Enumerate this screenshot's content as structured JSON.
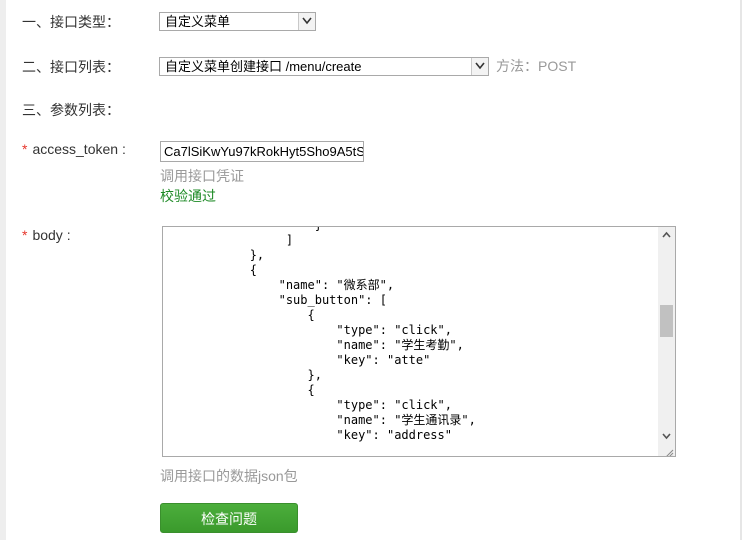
{
  "form": {
    "type_label": "一、接口类型：",
    "type_value": "自定义菜单",
    "list_label": "二、接口列表：",
    "list_value": "自定义菜单创建接口 /menu/create",
    "method_text": "方法：POST",
    "params_label": "三、参数列表：",
    "required_mark": "*",
    "token_label": "access_token :",
    "token_value": "Ca7lSiKwYu97kRokHyt5Sho9A5tS",
    "token_hint": "调用接口凭证",
    "token_status": "校验通过",
    "body_label": "body :",
    "body_hint": "调用接口的数据json包",
    "submit_label": "检查问题"
  },
  "body_code_lines": [
    "                     }",
    "                 ]",
    "            },",
    "            {",
    "                \"name\": \"微系部\",",
    "                \"sub_button\": [",
    "                    {",
    "                        \"type\": \"click\",",
    "                        \"name\": \"学生考勤\",",
    "                        \"key\": \"atte\"",
    "                    },",
    "                    {",
    "                        \"type\": \"click\",",
    "                        \"name\": \"学生通讯录\",",
    "                        \"key\": \"address\""
  ],
  "colors": {
    "required": "#e6362c",
    "success": "#1d8a25",
    "button": "#44a636",
    "muted": "#999999"
  }
}
